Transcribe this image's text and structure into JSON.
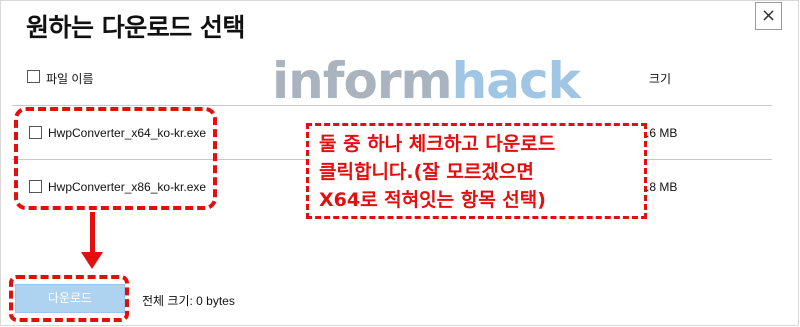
{
  "dialog": {
    "title": "원하는 다운로드 선택",
    "close_glyph": "×"
  },
  "watermark": {
    "part1": "inform",
    "part2": "hack"
  },
  "table": {
    "header_name": "파일 이름",
    "header_size": "크기",
    "rows": [
      {
        "name": "HwpConverter_x64_ko-kr.exe",
        "size": ".6 MB",
        "checked": false
      },
      {
        "name": "HwpConverter_x86_ko-kr.exe",
        "size": ".8 MB",
        "checked": false
      }
    ]
  },
  "footer": {
    "download_label": "다운로드",
    "total_label": "전체 크기: 0 bytes"
  },
  "annotation": {
    "lines": [
      "둘 중 하나 체크하고 다운로드",
      "클릭합니다.(잘 모르겠으면",
      "X64로 적혀잇는 항목 선택)"
    ],
    "color": "#e20f0f"
  }
}
